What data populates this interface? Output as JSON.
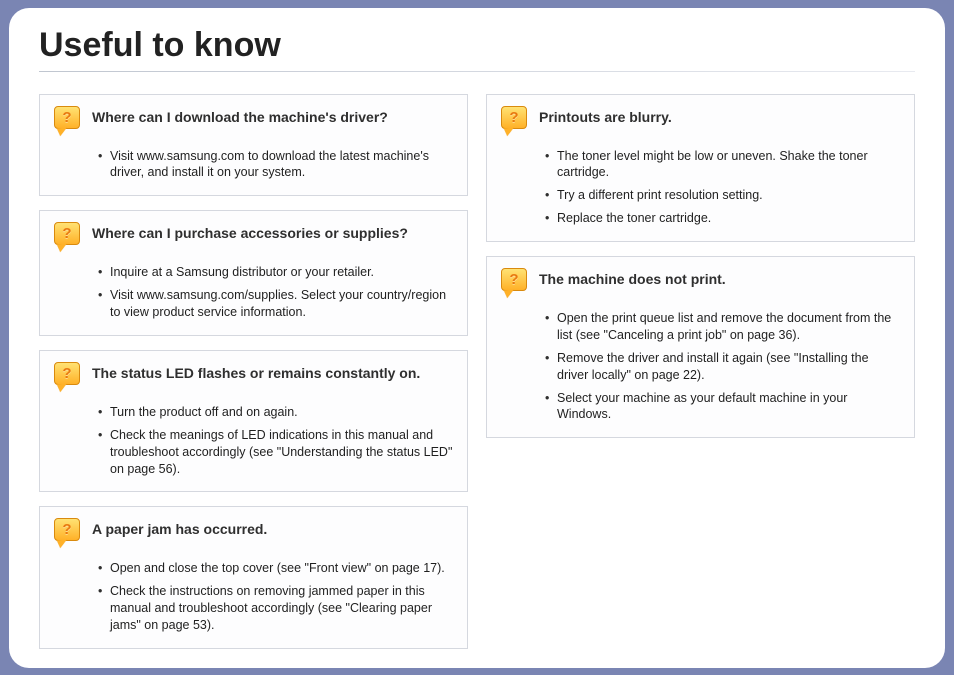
{
  "title": "Useful to know",
  "cards": {
    "download_driver": {
      "title": "Where can I download the machine's driver?",
      "items": [
        "Visit www.samsung.com to download the latest machine's driver, and install it on your system."
      ]
    },
    "purchase": {
      "title": "Where can I purchase accessories or supplies?",
      "items": [
        "Inquire at a Samsung distributor or your retailer.",
        "Visit www.samsung.com/supplies. Select your country/region to view product service information."
      ]
    },
    "status_led": {
      "title": "The status LED flashes or remains constantly on.",
      "items": [
        "Turn the product off and on again.",
        "Check the meanings of LED indications in this manual and troubleshoot accordingly (see \"Understanding the status LED\" on page 56)."
      ]
    },
    "paper_jam": {
      "title": "A paper jam has occurred.",
      "items": [
        "Open and close the top cover (see \"Front view\" on page 17).",
        "Check the instructions on removing jammed paper in this manual and troubleshoot accordingly (see \"Clearing paper jams\" on page 53)."
      ]
    },
    "blurry": {
      "title": "Printouts are blurry.",
      "items": [
        "The toner level might be low or uneven. Shake the toner cartridge.",
        "Try a different print resolution setting.",
        "Replace the toner cartridge."
      ]
    },
    "no_print": {
      "title": "The machine does not print.",
      "items": [
        "Open the print queue list and remove the document from the list (see \"Canceling a print job\" on page 36).",
        "Remove the driver and install it again (see \"Installing the driver locally\" on page 22).",
        "Select your machine as your default machine in your Windows."
      ]
    }
  }
}
